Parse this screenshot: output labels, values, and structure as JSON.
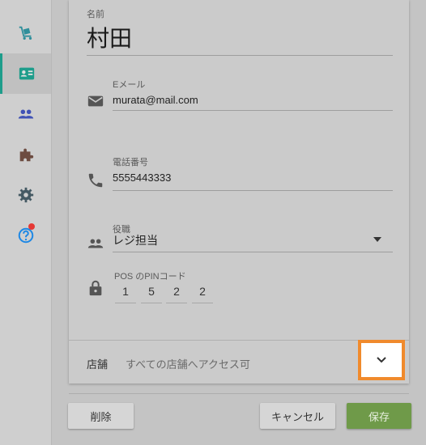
{
  "sidebar": {
    "items": [
      {
        "name": "cart",
        "icon": "cart-icon"
      },
      {
        "name": "staff-card",
        "icon": "id-card-icon",
        "active": true
      },
      {
        "name": "people",
        "icon": "people-icon"
      },
      {
        "name": "extensions",
        "icon": "puzzle-icon"
      },
      {
        "name": "settings",
        "icon": "gear-icon"
      },
      {
        "name": "help",
        "icon": "help-icon",
        "badge": true
      }
    ],
    "colors": {
      "active": "#1e9d8b",
      "icon": "#2f8f9b",
      "people": "#3f51b5",
      "puzzle": "#6d4c41",
      "gear": "#455a64",
      "help": "#1e88e5"
    }
  },
  "form": {
    "name_label": "名前",
    "name_value": "村田",
    "email_label": "Eメール",
    "email_value": "murata@mail.com",
    "phone_label": "電話番号",
    "phone_value": "5555443333",
    "role_label": "役職",
    "role_value": "レジ担当",
    "pin_label": "POS のPINコード",
    "pin_digits": [
      "1",
      "5",
      "2",
      "2"
    ]
  },
  "store": {
    "label": "店舗",
    "value": "すべての店舗へアクセス可"
  },
  "actions": {
    "delete": "削除",
    "cancel": "キャンセル",
    "save": "保存"
  },
  "colors": {
    "save": "#6f9a49",
    "highlight": "#f08a2c"
  }
}
